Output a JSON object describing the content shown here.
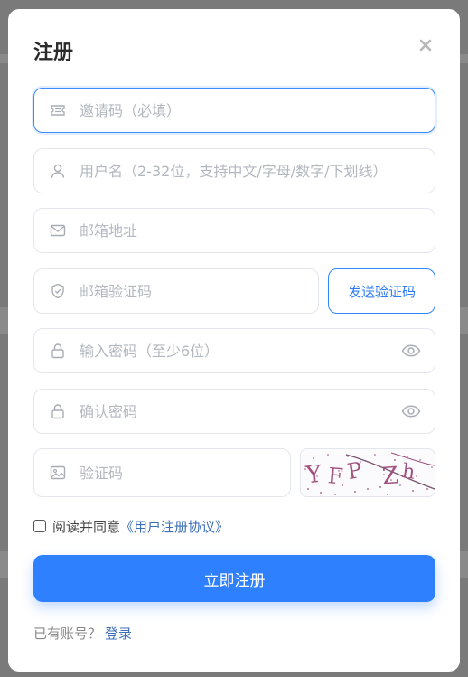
{
  "modal": {
    "title": "注册",
    "close_icon": "close-icon"
  },
  "fields": {
    "invite": {
      "placeholder": "邀请码（必填）",
      "icon": "ticket-icon"
    },
    "username": {
      "placeholder": "用户名（2-32位，支持中文/字母/数字/下划线）",
      "icon": "user-icon"
    },
    "email": {
      "placeholder": "邮箱地址",
      "icon": "mail-icon"
    },
    "email_code": {
      "placeholder": "邮箱验证码",
      "icon": "shield-icon"
    },
    "password": {
      "placeholder": "输入密码（至少6位）",
      "icon": "lock-icon"
    },
    "confirm_password": {
      "placeholder": "确认密码",
      "icon": "lock-icon"
    },
    "captcha": {
      "placeholder": "验证码",
      "icon": "image-icon"
    }
  },
  "send_code_label": "发送验证码",
  "captcha_image_text": "YFP Zh",
  "agreement": {
    "prefix": "阅读并同意",
    "link": "《用户注册协议》"
  },
  "submit_label": "立即注册",
  "login": {
    "prompt": "已有账号？",
    "link": "登录"
  },
  "colors": {
    "accent": "#2e80ff",
    "link": "#3d6fb8",
    "placeholder": "#b3b8c0"
  }
}
